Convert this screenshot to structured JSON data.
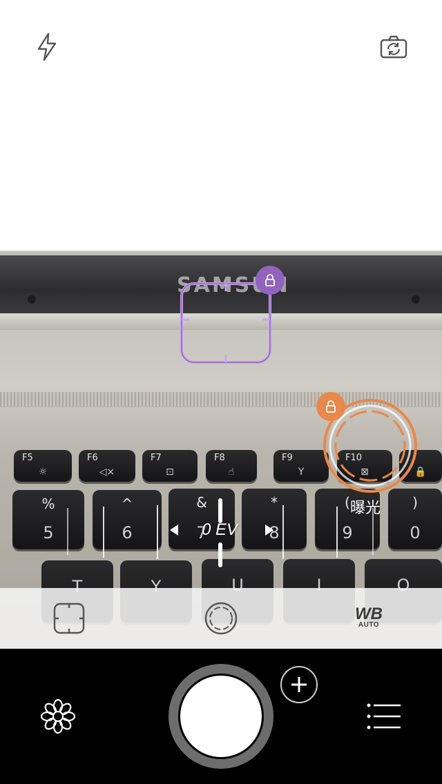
{
  "top_bar": {
    "flash_icon": "flash-icon",
    "switch_camera_icon": "switch-camera-icon"
  },
  "scene": {
    "brand": "SAMSUN",
    "keys_fn": [
      {
        "label": "F5",
        "icon": "☼"
      },
      {
        "label": "F6",
        "icon": "◁×"
      },
      {
        "label": "F7",
        "icon": "⊡"
      },
      {
        "label": "F8",
        "icon": "☝"
      },
      {
        "label": "F9",
        "icon": "Y"
      },
      {
        "label": "F10",
        "icon": "⊠"
      },
      {
        "label": "",
        "icon": "🔒"
      }
    ],
    "keys_num": [
      {
        "top": "%",
        "bottom": "5"
      },
      {
        "top": "^",
        "bottom": "6"
      },
      {
        "top": "&",
        "bottom": "7"
      },
      {
        "top": "*",
        "bottom": "8"
      },
      {
        "top": "(",
        "bottom": "9"
      },
      {
        "top": ")",
        "bottom": "0"
      }
    ],
    "keys_letters": [
      "T",
      "Y",
      "U",
      "I",
      "O"
    ]
  },
  "focus": {
    "lock_icon": "lock-icon",
    "accent_color": "#9163bf"
  },
  "exposure": {
    "label": "曝光",
    "lock_icon": "lock-icon",
    "accent_color": "#e8884a"
  },
  "ev_scale": {
    "value": "0 EV"
  },
  "mode_bar": {
    "focus_mode_icon": "focus-frame-icon",
    "exposure_mode_icon": "exposure-circle-icon",
    "wb_label": "WB",
    "wb_sub": "AUTO"
  },
  "bottom_bar": {
    "filter_icon": "flower-icon",
    "plus_icon": "plus-icon",
    "menu_icon": "menu-icon"
  }
}
